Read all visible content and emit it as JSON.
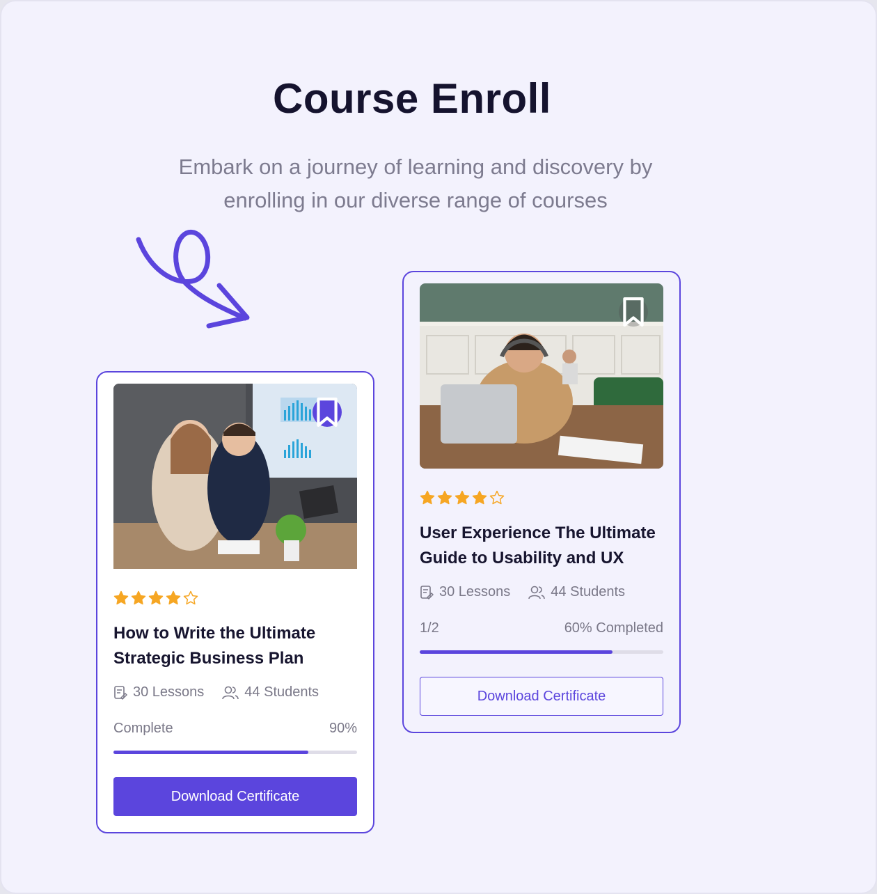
{
  "header": {
    "title": "Course Enroll",
    "subtitle": "Embark on a journey of learning and discovery by\nenrolling in our diverse range of courses"
  },
  "colors": {
    "accent": "#5b45dd",
    "star": "#f6a623",
    "background": "#f3f2fd"
  },
  "courses": [
    {
      "image": "business-meeting-photo",
      "bookmark_icon": "bookmark-icon",
      "rating": 4,
      "max_rating": 5,
      "title": "How to Write the Ultimate Strategic Business Plan",
      "lessons": "30 Lessons",
      "students": "44 Students",
      "progress_label": "Complete",
      "progress_value_text": "90%",
      "progress_fraction": 0.8,
      "button_label": "Download Certificate",
      "button_style": "filled"
    },
    {
      "image": "man-with-headphones-laptop-photo",
      "bookmark_icon": "bookmark-icon",
      "rating": 4,
      "max_rating": 5,
      "title": "User Experience The Ultimate Guide to Usability and UX",
      "lessons": "30 Lessons",
      "students": "44 Students",
      "progress_label": "1/2",
      "progress_value_text": "60% Completed",
      "progress_fraction": 0.79,
      "button_label": "Download Certificate",
      "button_style": "outline"
    }
  ]
}
